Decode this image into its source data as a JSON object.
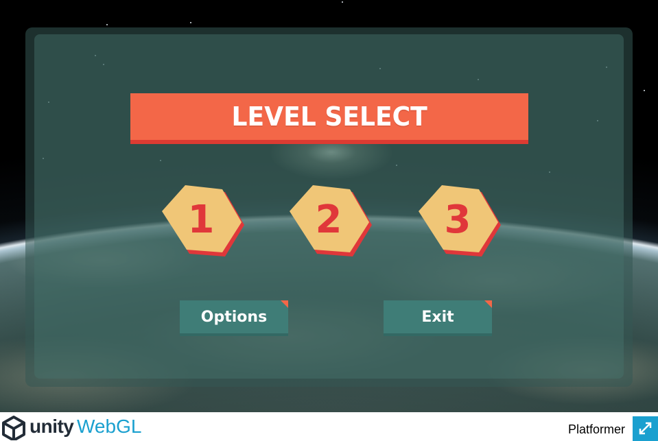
{
  "game": {
    "title": "LEVEL SELECT",
    "levels": [
      "1",
      "2",
      "3"
    ],
    "options_label": "Options",
    "exit_label": "Exit"
  },
  "footer": {
    "brand": "unity",
    "brand_suffix": "WebGL",
    "app_title": "Platformer",
    "fullscreen_icon": "fullscreen-icon"
  },
  "colors": {
    "title_bar": "#f36748",
    "title_bar_shadow": "#dc3b32",
    "hex_fill": "#f0c677",
    "hex_shadow": "#e0373a",
    "button_fill": "#3f7d77",
    "webgl_blue": "#1aa0cf"
  }
}
